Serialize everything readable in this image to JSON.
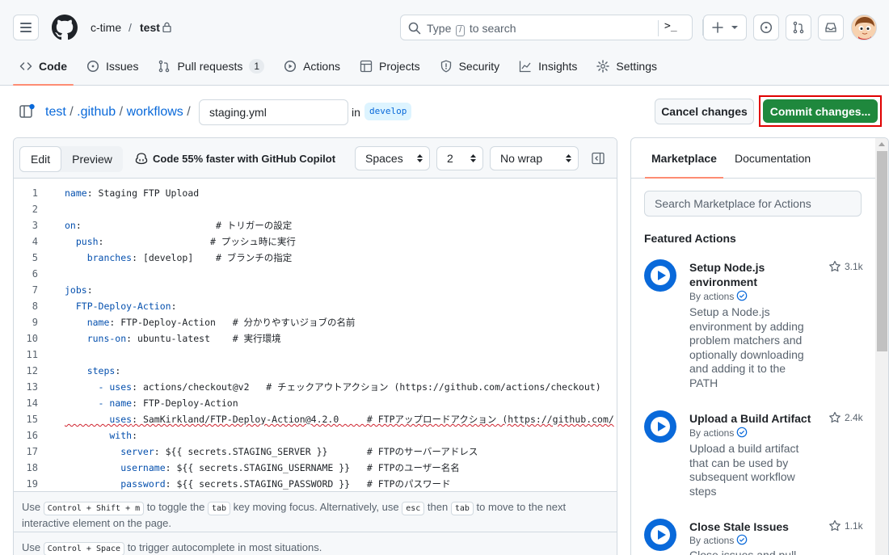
{
  "header": {
    "owner": "c-time",
    "separator": "/",
    "repo": "test",
    "search": {
      "placeholder_before": "Type",
      "placeholder_key": "/",
      "placeholder_after": "to search",
      "command_icon": ">_"
    }
  },
  "nav": [
    {
      "label": "Code",
      "icon": "code-icon",
      "active": true
    },
    {
      "label": "Issues",
      "icon": "issue-icon"
    },
    {
      "label": "Pull requests",
      "icon": "pull-request-icon",
      "count": "1"
    },
    {
      "label": "Actions",
      "icon": "play-icon"
    },
    {
      "label": "Projects",
      "icon": "table-icon"
    },
    {
      "label": "Security",
      "icon": "shield-icon"
    },
    {
      "label": "Insights",
      "icon": "graph-icon"
    },
    {
      "label": "Settings",
      "icon": "gear-icon"
    }
  ],
  "file": {
    "path": [
      {
        "label": "test"
      },
      {
        "label": ".github"
      },
      {
        "label": "workflows"
      }
    ],
    "separator": "/",
    "filename": "staging.yml",
    "in_label": "in",
    "branch": "develop",
    "cancel_label": "Cancel changes",
    "commit_label": "Commit changes..."
  },
  "editor": {
    "tabs": [
      "Edit",
      "Preview"
    ],
    "copilot": "Code 55% faster with GitHub Copilot",
    "indent_mode": "Spaces",
    "indent_size": "2",
    "wrap_mode": "No wrap",
    "lines": [
      {
        "n": "1",
        "key": "name",
        "rest": ": Staging FTP Upload"
      },
      {
        "n": "2",
        "key": "",
        "rest": ""
      },
      {
        "n": "3",
        "key": "on",
        "rest": ":                        # トリガーの設定"
      },
      {
        "n": "4",
        "key": "  push",
        "rest": ":                   # プッシュ時に実行"
      },
      {
        "n": "5",
        "key": "    branches",
        "rest": ": [develop]    # ブランチの指定"
      },
      {
        "n": "6",
        "key": "",
        "rest": ""
      },
      {
        "n": "7",
        "key": "jobs",
        "rest": ":"
      },
      {
        "n": "8",
        "key": "  FTP-Deploy-Action",
        "rest": ":"
      },
      {
        "n": "9",
        "key": "    name",
        "rest": ": FTP-Deploy-Action   # 分かりやすいジョブの名前"
      },
      {
        "n": "10",
        "key": "    runs-on",
        "rest": ": ubuntu-latest    # 実行環境"
      },
      {
        "n": "11",
        "key": "",
        "rest": ""
      },
      {
        "n": "12",
        "key": "    steps",
        "rest": ":"
      },
      {
        "n": "13",
        "key": "      - uses",
        "rest": ": actions/checkout@v2   # チェックアウトアクション (https://github.com/actions/checkout)"
      },
      {
        "n": "14",
        "key": "      - name",
        "rest": ": FTP-Deploy-Action"
      },
      {
        "n": "15",
        "key": "        uses",
        "rest": ": SamKirkland/FTP-Deploy-Action@4.2.0     # FTPアップロードアクション (https://github.com/",
        "wavy": true
      },
      {
        "n": "16",
        "key": "        with",
        "rest": ":"
      },
      {
        "n": "17",
        "key": "          server",
        "rest": ": ${{ secrets.STAGING_SERVER }}       # FTPのサーバーアドレス"
      },
      {
        "n": "18",
        "key": "          username",
        "rest": ": ${{ secrets.STAGING_USERNAME }}   # FTPのユーザー名名"
      },
      {
        "n": "19",
        "key": "          password",
        "rest": ": ${{ secrets.STAGING_PASSWORD }}   # FTPのパスワード"
      }
    ],
    "hint1": {
      "use": "Use",
      "k1": "Control + Shift + m",
      "t1": "to toggle the",
      "k2": "tab",
      "t2": "key moving focus. Alternatively, use",
      "k3": "esc",
      "t3": "then",
      "k4": "tab",
      "t4": "to move to the next interactive element on the page."
    },
    "hint2": {
      "use": "Use",
      "k1": "Control + Space",
      "t1": "to trigger autocomplete in most situations."
    }
  },
  "marketplace": {
    "tabs": [
      "Marketplace",
      "Documentation"
    ],
    "search_placeholder": "Search Marketplace for Actions",
    "featured_title": "Featured Actions",
    "actions": [
      {
        "name": "Setup Node.js environment",
        "by": "By actions",
        "stars": "3.1k",
        "desc": "Setup a Node.js environment by adding problem matchers and optionally downloading and adding it to the PATH"
      },
      {
        "name": "Upload a Build Artifact",
        "by": "By actions",
        "stars": "2.4k",
        "desc": "Upload a build artifact that can be used by subsequent workflow steps"
      },
      {
        "name": "Close Stale Issues",
        "by": "By actions",
        "stars": "1.1k",
        "desc": "Close issues and pull"
      }
    ]
  },
  "colors": {
    "accent": "#0969da",
    "commit_green": "#1f883d",
    "highlight_red": "#e00000",
    "nav_underline": "#fd8c73"
  }
}
